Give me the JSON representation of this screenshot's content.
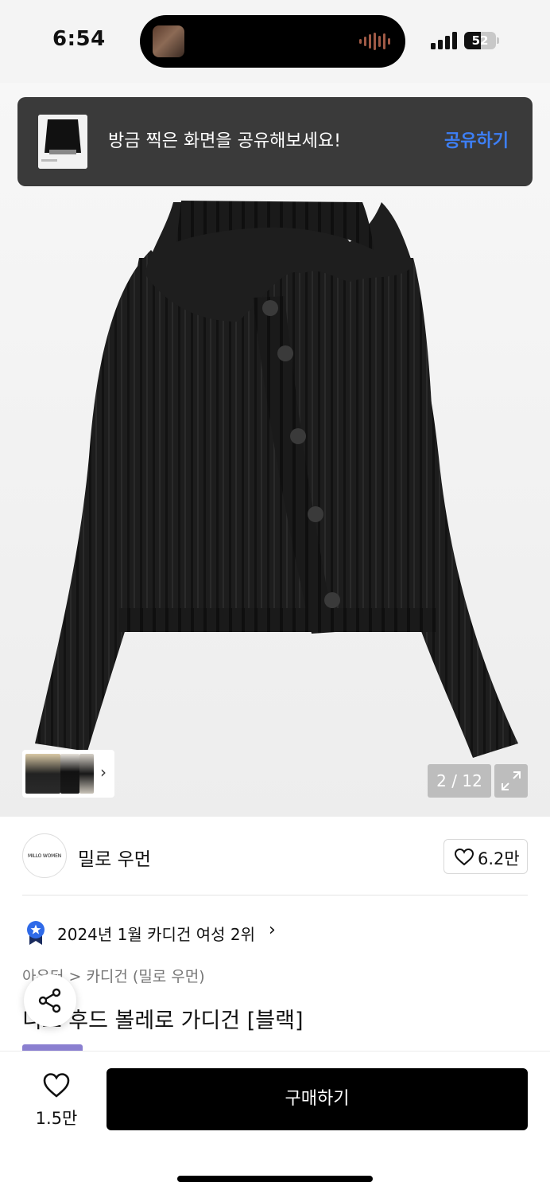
{
  "status_bar": {
    "time": "6:54",
    "battery_level": "52",
    "icons": [
      "island-thumb-icon",
      "audio-wave-icon",
      "signal-icon",
      "battery-icon"
    ]
  },
  "share_banner": {
    "message": "방금 찍은 화면을 공유해보세요!",
    "action": "공유하기",
    "action_color": "#3d7ff6"
  },
  "gallery": {
    "counter": "2 / 12",
    "thumb_chevron": "›"
  },
  "brand": {
    "logo_text": "MILLO WOMEN",
    "name": "밀로 우먼",
    "like_count": "6.2만"
  },
  "ranking": {
    "text": "2024년 1월 카디건 여성 2위",
    "chevron": "›"
  },
  "product": {
    "breadcrumb": "아우터 > 카디건 (밀로 우먼)",
    "title": "니트 후드 볼레로 가디건 [블랙]"
  },
  "bottom_bar": {
    "like_count": "1.5만",
    "buy_label": "구매하기"
  },
  "colors": {
    "accent_blue": "#3d7ff6",
    "tag_purple": "#8a7fd0",
    "buy_button": "#000000"
  }
}
